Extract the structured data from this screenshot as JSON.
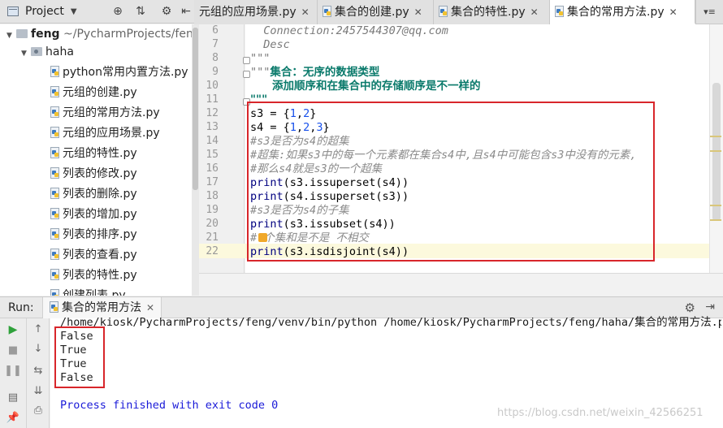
{
  "project_panel": {
    "title": "Project",
    "root": {
      "name": "feng",
      "path": "~/PycharmProjects/feng"
    },
    "package": "haha",
    "files": [
      "python常用内置方法.py",
      "元组的创建.py",
      "元组的常用方法.py",
      "元组的应用场景.py",
      "元组的特性.py",
      "列表的修改.py",
      "列表的删除.py",
      "列表的增加.py",
      "列表的排序.py",
      "列表的查看.py",
      "列表的特性.py",
      "创建列表.py"
    ]
  },
  "editor_tabs": [
    {
      "label": "元组的应用场景.py",
      "active": false
    },
    {
      "label": "集合的创建.py",
      "active": false
    },
    {
      "label": "集合的特性.py",
      "active": false
    },
    {
      "label": "集合的常用方法.py",
      "active": true
    }
  ],
  "editor": {
    "line_numbers": [
      "6",
      "7",
      "8",
      "9",
      "10",
      "11",
      "12",
      "13",
      "14",
      "15",
      "16",
      "17",
      "18",
      "19",
      "20",
      "21",
      "22"
    ],
    "doc_lines": [
      "  Connection:2457544307@qq.com",
      "  Desc"
    ],
    "docstring_close": "\"\"\"",
    "docstring_open": "\"\"\"",
    "doc_title": "集合：无序的数据类型",
    "doc_sub": "添加顺序和在集合中的存储顺序是不一样的",
    "docstring_end": "\"\"\"",
    "code": {
      "s3": {
        "name": "s3 = {",
        "n1": "1",
        "sep": ",",
        "n2": "2",
        "end": "}"
      },
      "s4": {
        "name": "s4 = {",
        "n1": "1",
        "sep1": ",",
        "n2": "2",
        "sep2": ",",
        "n3": "3",
        "end": "}"
      },
      "c1": "#s3是否为s4的超集",
      "c2": "#超集:如果s3中的每一个元素都在集合s4中,且s4中可能包含s3中没有的元素,",
      "c3": "#那么s4就是s3的一个超集",
      "p1": {
        "fn": "print",
        "args": "(s3.issuperset(s4))"
      },
      "p2": {
        "fn": "print",
        "args": "(s4.issuperset(s3))"
      },
      "c4": "#s3是否为s4的子集",
      "p3": {
        "fn": "print",
        "args": "(s3.issubset(s4))"
      },
      "c5": "# 个集和是不是 不相交",
      "p4": {
        "fn": "print",
        "args": "(s3.isdisjoint(s4))"
      }
    }
  },
  "run_panel": {
    "label": "Run:",
    "tab": "集合的常用方法",
    "command": "/home/kiosk/PycharmProjects/feng/venv/bin/python /home/kiosk/PycharmProjects/feng/haha/集合的常用方法.py",
    "output": [
      "False",
      "True",
      "True",
      "False"
    ],
    "exit_message": "Process finished with exit code 0"
  },
  "watermark": "https://blog.csdn.net/weixin_42566251",
  "colors": {
    "highlight_box": "#d8262b",
    "number": "#1750eb",
    "keyword": "#000080",
    "doc_bold": "#0a7a6b"
  }
}
